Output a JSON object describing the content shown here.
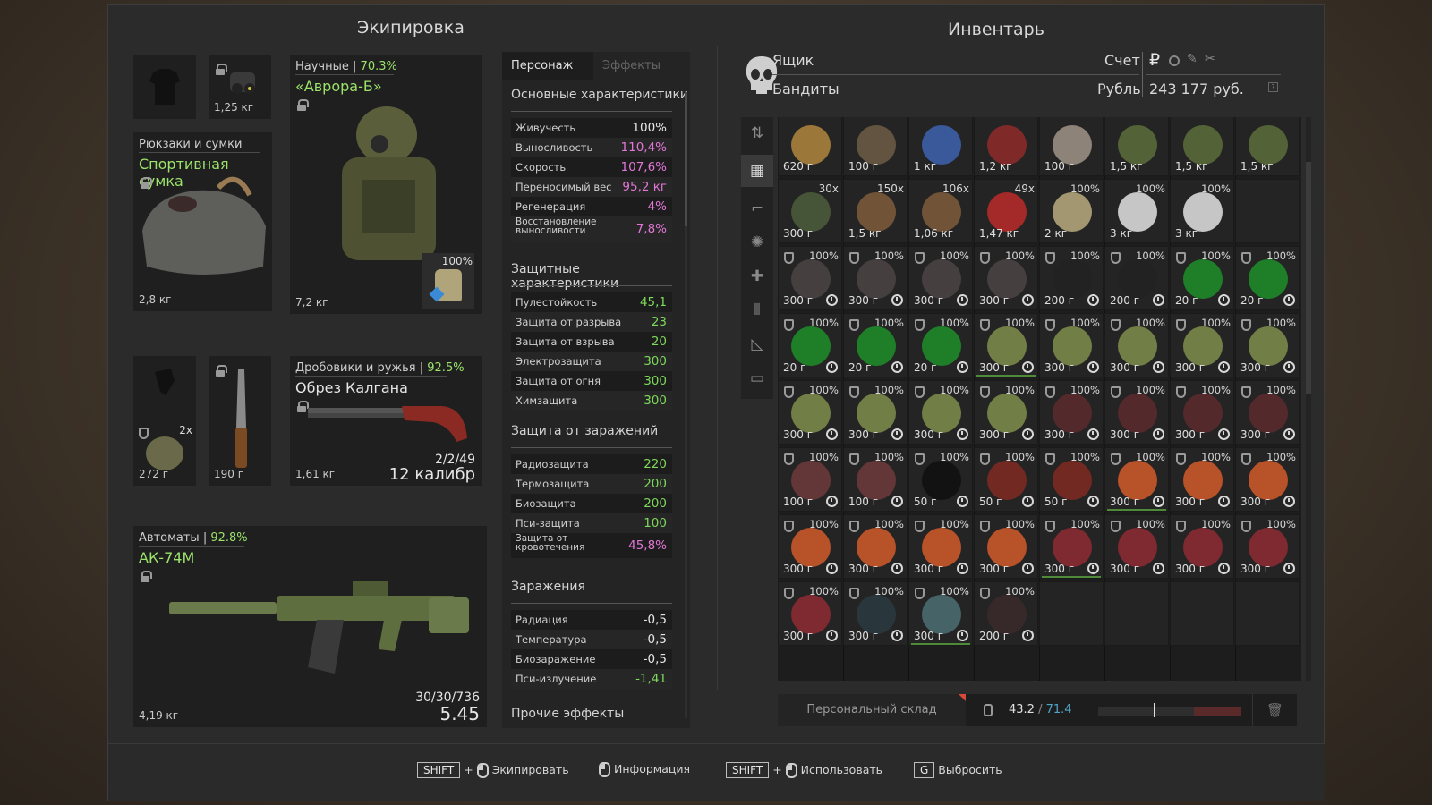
{
  "equipment": {
    "title": "Экипировка",
    "armor_slot_top_weight": "1,25 кг",
    "backpack": {
      "label": "Рюкзаки и сумки",
      "name": "Спортивная сумка",
      "weight": "2,8 кг"
    },
    "armor": {
      "label": "Научные",
      "pct": "70.3%",
      "name": "«Аврора-Б»",
      "weight": "7,2 кг",
      "container_pct": "100%"
    },
    "misc_slot": {
      "count": "2x",
      "weight": "272 г"
    },
    "knife": {
      "weight": "190 г"
    },
    "shotgun": {
      "label": "Дробовики и ружья",
      "pct": "92.5%",
      "name": "Обрез Калгана",
      "weight": "1,61 кг",
      "ammo": "2/2/49",
      "caliber": "12 калибр"
    },
    "rifle": {
      "label": "Автоматы",
      "pct": "92.8%",
      "name": "АК-74М",
      "weight": "4,19 кг",
      "ammo": "30/30/736",
      "caliber": "5.45"
    }
  },
  "stats": {
    "tabs": [
      "Персонаж",
      "Эффекты"
    ],
    "basic": {
      "title": "Основные характеристики",
      "rows": [
        {
          "k": "Живучесть",
          "v": "100%",
          "c": "white"
        },
        {
          "k": "Выносливость",
          "v": "110,4%",
          "c": "pink"
        },
        {
          "k": "Скорость",
          "v": "107,6%",
          "c": "pink"
        },
        {
          "k": "Переносимый вес",
          "v": "95,2 кг",
          "c": "pink"
        },
        {
          "k": "Регенерация",
          "v": "4%",
          "c": "pink"
        },
        {
          "k": "Восстановление выносливости",
          "v": "7,8%",
          "c": "pink"
        }
      ]
    },
    "protection": {
      "title": "Защитные характеристики",
      "rows": [
        {
          "k": "Пулестойкость",
          "v": "45,1"
        },
        {
          "k": "Защита от разрыва",
          "v": "23"
        },
        {
          "k": "Защита от взрыва",
          "v": "20"
        },
        {
          "k": "Электрозащита",
          "v": "300"
        },
        {
          "k": "Защита от огня",
          "v": "300"
        },
        {
          "k": "Химзащита",
          "v": "300"
        }
      ]
    },
    "contamination_protection": {
      "title": "Защита от заражений",
      "rows": [
        {
          "k": "Радиозащита",
          "v": "220",
          "c": "green"
        },
        {
          "k": "Термозащита",
          "v": "200",
          "c": "green"
        },
        {
          "k": "Биозащита",
          "v": "200",
          "c": "green"
        },
        {
          "k": "Пси-защита",
          "v": "100",
          "c": "green"
        },
        {
          "k": "Защита от кровотечения",
          "v": "45,8%",
          "c": "pink"
        }
      ]
    },
    "contaminations": {
      "title": "Заражения",
      "rows": [
        {
          "k": "Радиация",
          "v": "-0,5",
          "c": "white"
        },
        {
          "k": "Температура",
          "v": "-0,5",
          "c": "white"
        },
        {
          "k": "Биозаражение",
          "v": "-0,5",
          "c": "white"
        },
        {
          "k": "Пси-излучение",
          "v": "-1,41",
          "c": "green"
        }
      ]
    },
    "other": {
      "title": "Прочие эффекты"
    }
  },
  "inventory": {
    "title": "Инвентарь",
    "box_label": "Ящик",
    "faction": "Бандиты",
    "account_label": "Счет",
    "currency_label": "Рубль",
    "balance": "243 177 руб.",
    "rows": [
      [
        {
          "w": "620 г",
          "c": "#a8823c"
        },
        {
          "w": "100 г",
          "c": "#6a5a45"
        },
        {
          "w": "1 кг",
          "c": "#3c5fa8"
        },
        {
          "w": "1,2 кг",
          "c": "#8a2a2a"
        },
        {
          "w": "100 г",
          "c": "#9a8e82"
        },
        {
          "w": "1,5 кг",
          "c": "#5a6a3a"
        },
        {
          "w": "1,5 кг",
          "c": "#5a6a3a"
        },
        {
          "w": "1,5 кг",
          "c": "#5a6a3a"
        }
      ],
      [
        {
          "w": "300 г",
          "q": "30x",
          "c": "#4a5a3a"
        },
        {
          "w": "1,5 кг",
          "q": "150x",
          "c": "#7a5a3a"
        },
        {
          "w": "1,06 кг",
          "q": "106x",
          "c": "#7a5a3a"
        },
        {
          "w": "1,47 кг",
          "q": "49x",
          "c": "#b22a2a"
        },
        {
          "w": "2 кг",
          "p": "100%",
          "c": "#b0a47a"
        },
        {
          "w": "3 кг",
          "p": "100%",
          "c": "#d8d8d8"
        },
        {
          "w": "3 кг",
          "p": "100%",
          "c": "#d8d8d8"
        },
        null
      ],
      [
        {
          "w": "300 г",
          "p": "100%",
          "c": "#4a4244",
          "t": 1
        },
        {
          "w": "300 г",
          "p": "100%",
          "c": "#4a4244",
          "t": 1
        },
        {
          "w": "300 г",
          "p": "100%",
          "c": "#4a4244",
          "t": 1
        },
        {
          "w": "300 г",
          "p": "100%",
          "c": "#4a4244",
          "t": 1
        },
        {
          "w": "200 г",
          "p": "100%",
          "c": "#222222",
          "t": 1
        },
        {
          "w": "200 г",
          "p": "100%",
          "c": "#222222",
          "t": 1
        },
        {
          "w": "20 г",
          "p": "100%",
          "c": "#1f8a2a",
          "t": 1
        },
        {
          "w": "20 г",
          "p": "100%",
          "c": "#1f8a2a",
          "t": 1
        }
      ],
      [
        {
          "w": "20 г",
          "p": "100%",
          "c": "#1f8a2a",
          "t": 1
        },
        {
          "w": "20 г",
          "p": "100%",
          "c": "#1f8a2a",
          "t": 1
        },
        {
          "w": "20 г",
          "p": "100%",
          "c": "#1f8a2a",
          "t": 1
        },
        {
          "w": "300 г",
          "p": "100%",
          "c": "#7a8a4a",
          "t": 1,
          "b": 1
        },
        {
          "w": "300 г",
          "p": "100%",
          "c": "#7a8a4a",
          "t": 1
        },
        {
          "w": "300 г",
          "p": "100%",
          "c": "#7a8a4a",
          "t": 1
        },
        {
          "w": "300 г",
          "p": "100%",
          "c": "#7a8a4a",
          "t": 1
        },
        {
          "w": "300 г",
          "p": "100%",
          "c": "#7a8a4a",
          "t": 1
        }
      ],
      [
        {
          "w": "300 г",
          "p": "100%",
          "c": "#7a8a4a",
          "t": 1
        },
        {
          "w": "300 г",
          "p": "100%",
          "c": "#7a8a4a",
          "t": 1
        },
        {
          "w": "300 г",
          "p": "100%",
          "c": "#7a8a4a",
          "t": 1
        },
        {
          "w": "300 г",
          "p": "100%",
          "c": "#7a8a4a",
          "t": 1
        },
        {
          "w": "300 г",
          "p": "100%",
          "c": "#5a2a2e",
          "t": 1
        },
        {
          "w": "300 г",
          "p": "100%",
          "c": "#5a2a2e",
          "t": 1
        },
        {
          "w": "300 г",
          "p": "100%",
          "c": "#5a2a2e",
          "t": 1
        },
        {
          "w": "300 г",
          "p": "100%",
          "c": "#5a2a2e",
          "t": 1
        }
      ],
      [
        {
          "w": "100 г",
          "p": "100%",
          "c": "#6a3a3a",
          "t": 1
        },
        {
          "w": "100 г",
          "p": "100%",
          "c": "#6a3a3a",
          "t": 1
        },
        {
          "w": "50 г",
          "p": "100%",
          "c": "#111111",
          "t": 1
        },
        {
          "w": "50 г",
          "p": "100%",
          "c": "#7a2a22",
          "t": 1
        },
        {
          "w": "50 г",
          "p": "100%",
          "c": "#7a2a22",
          "t": 1
        },
        {
          "w": "300 г",
          "p": "100%",
          "c": "#c8582a",
          "t": 1,
          "b": 1
        },
        {
          "w": "300 г",
          "p": "100%",
          "c": "#c8582a",
          "t": 1
        },
        {
          "w": "300 г",
          "p": "100%",
          "c": "#c8582a",
          "t": 1
        }
      ],
      [
        {
          "w": "300 г",
          "p": "100%",
          "c": "#c8582a",
          "t": 1
        },
        {
          "w": "300 г",
          "p": "100%",
          "c": "#c8582a",
          "t": 1
        },
        {
          "w": "300 г",
          "p": "100%",
          "c": "#c8582a",
          "t": 1
        },
        {
          "w": "300 г",
          "p": "100%",
          "c": "#c8582a",
          "t": 1
        },
        {
          "w": "300 г",
          "p": "100%",
          "c": "#8a2a32",
          "t": 1,
          "b": 1
        },
        {
          "w": "300 г",
          "p": "100%",
          "c": "#8a2a32",
          "t": 1
        },
        {
          "w": "300 г",
          "p": "100%",
          "c": "#8a2a32",
          "t": 1
        },
        {
          "w": "300 г",
          "p": "100%",
          "c": "#8a2a32",
          "t": 1
        }
      ],
      [
        {
          "w": "300 г",
          "p": "100%",
          "c": "#8a2a32",
          "t": 1
        },
        {
          "w": "300 г",
          "p": "100%",
          "c": "#2a3a40",
          "t": 1
        },
        {
          "w": "300 г",
          "p": "100%",
          "c": "#4a6a70",
          "t": 1,
          "b": 1
        },
        {
          "w": "200 г",
          "p": "100%",
          "c": "#3a2a2a",
          "t": 1
        },
        null,
        null,
        null,
        null
      ]
    ],
    "storage_label": "Персональный склад",
    "weight_current": "43.2",
    "weight_sep": "/",
    "weight_max": "71.4"
  },
  "hints": [
    {
      "key": "SHIFT",
      "plus": "+",
      "label": "Экипировать"
    },
    {
      "label": "Информация"
    },
    {
      "key": "SHIFT",
      "plus": "+",
      "label": "Использовать"
    },
    {
      "key": "G",
      "label": "Выбросить"
    }
  ],
  "colors": {
    "accent_green": "#9be36a",
    "stat_pink": "#e277d6",
    "stat_green": "#7dd95a"
  }
}
